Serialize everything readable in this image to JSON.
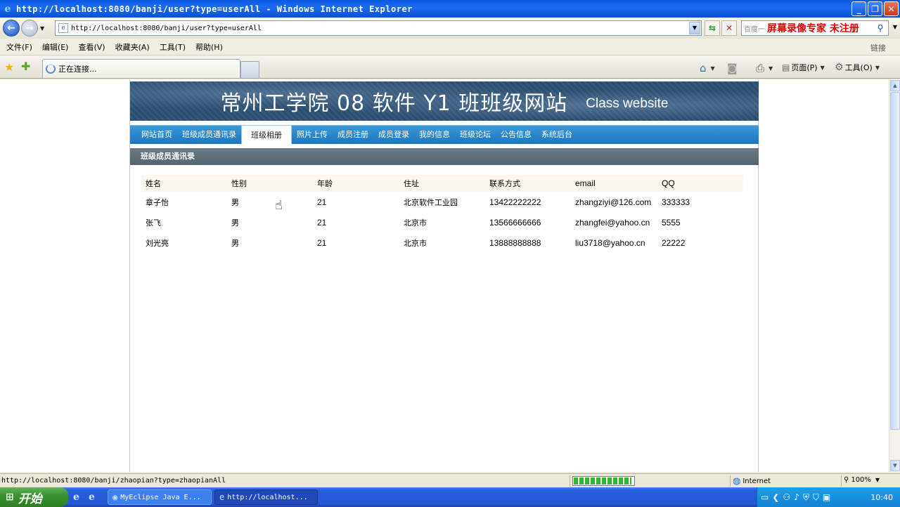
{
  "window": {
    "title": "http://localhost:8080/banji/user?type=userAll - Windows Internet Explorer",
    "minimize": "_",
    "restore": "❐",
    "close": "✕"
  },
  "address_bar": {
    "url": "http://localhost:8080/banji/user?type=userAll",
    "search_placeholder": "百度一",
    "watermark": "屏幕录像专家 未注册"
  },
  "menu": {
    "items": [
      "文件(F)",
      "编辑(E)",
      "查看(V)",
      "收藏夹(A)",
      "工具(T)",
      "帮助(H)"
    ],
    "links_label": "链接"
  },
  "tabs": {
    "active_label": "正在连接...",
    "page_label": "页面(P)",
    "tools_label": "工具(O)"
  },
  "site": {
    "banner_title": "常州工学院 08 软件 Y1 班班级网站",
    "banner_subtitle": "Class website",
    "nav": [
      "网站首页",
      "班级成员通讯录",
      "班级相册",
      "照片上传",
      "成员注册",
      "成员登录",
      "我的信息",
      "班级论坛",
      "公告信息",
      "系统后台"
    ],
    "active_nav_index": 2,
    "section_title": "班级成员通讯录",
    "table": {
      "headers": [
        "姓名",
        "性别",
        "年龄",
        "住址",
        "联系方式",
        "email",
        "QQ"
      ],
      "rows": [
        [
          "章子怡",
          "男",
          "21",
          "北京软件工业园",
          "13422222222",
          "zhangziyi@126.com",
          "333333"
        ],
        [
          "张飞",
          "男",
          "21",
          "北京市",
          "13566666666",
          "zhangfei@yahoo.cn",
          "5555"
        ],
        [
          "刘光亮",
          "男",
          "21",
          "北京市",
          "13888888888",
          "liu3718@yahoo.cn",
          "22222"
        ]
      ]
    }
  },
  "status": {
    "text": "http://localhost:8080/banji/zhaopian?type=zhaopianAll",
    "progress_fraction": 0.97,
    "zone": "Internet",
    "zoom": "100%"
  },
  "taskbar": {
    "start_label": "开始",
    "tasks": [
      "MyEclipse Java E...",
      "http://localhost..."
    ],
    "clock": "10:40"
  },
  "colors": {
    "nav_blue": "#2a86cc",
    "section_header": "#5f6e79",
    "watermark_red": "#e00000"
  }
}
